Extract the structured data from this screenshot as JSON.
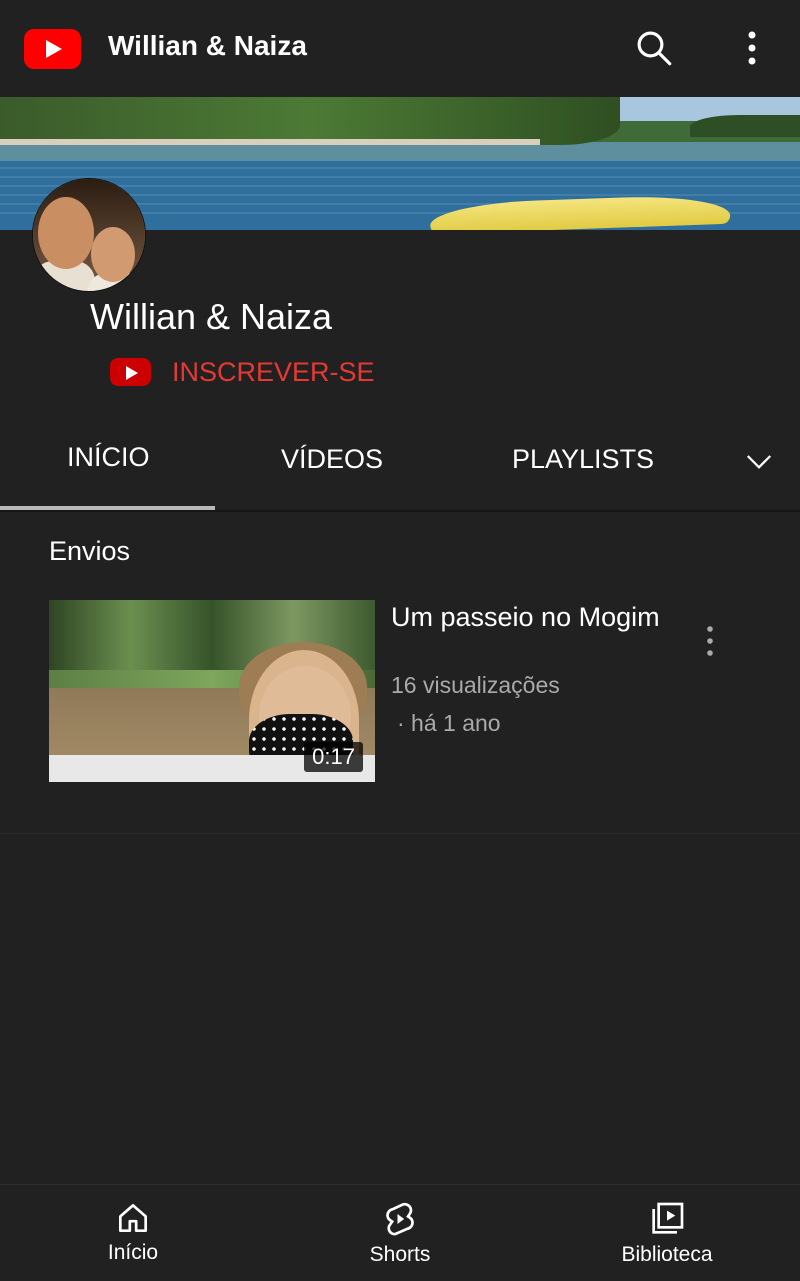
{
  "header": {
    "title": "Willian & Naiza",
    "logo_icon": "youtube-logo-icon",
    "search_icon": "search-icon",
    "more_icon": "more-vert-icon"
  },
  "channel": {
    "name": "Willian & Naiza",
    "subscribe_label": "INSCREVER-SE",
    "subscribe_icon": "youtube-play-icon"
  },
  "tabs": [
    {
      "label": "INÍCIO",
      "active": true
    },
    {
      "label": "VÍDEOS",
      "active": false
    },
    {
      "label": "PLAYLISTS",
      "active": false
    }
  ],
  "tabs_expand_icon": "chevron-down-icon",
  "section": {
    "title": "Envios"
  },
  "video": {
    "title": "Um passeio no Mogim",
    "views": "16 visualizações",
    "age": "· há 1 ano",
    "duration": "0:17"
  },
  "bottom_nav": [
    {
      "label": "Início",
      "icon": "home-icon"
    },
    {
      "label": "Shorts",
      "icon": "shorts-icon"
    },
    {
      "label": "Biblioteca",
      "icon": "library-icon"
    }
  ],
  "colors": {
    "background": "#212121",
    "subscribe_red": "#e53935",
    "brand_red": "#ff0000",
    "meta_text": "#aaaaaa"
  }
}
